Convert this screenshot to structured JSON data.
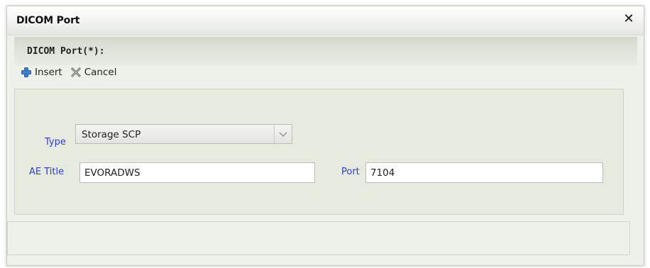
{
  "dialog": {
    "title": "DICOM Port",
    "close_icon": "close-icon"
  },
  "section": {
    "title": "DICOM Port(*):"
  },
  "toolbar": {
    "insert_label": "Insert",
    "insert_icon": "plus-icon",
    "cancel_label": "Cancel",
    "cancel_icon": "cancel-x-icon"
  },
  "form": {
    "type_label": "Type",
    "type_value": "Storage SCP",
    "ae_title_label": "AE Title",
    "ae_title_value": "EVORADWS",
    "port_label": "Port",
    "port_value": "7104"
  },
  "colors": {
    "label_blue": "#2a3fd0",
    "insert_icon_blue": "#3d7fd0",
    "cancel_icon_gray": "#7a7d78"
  }
}
